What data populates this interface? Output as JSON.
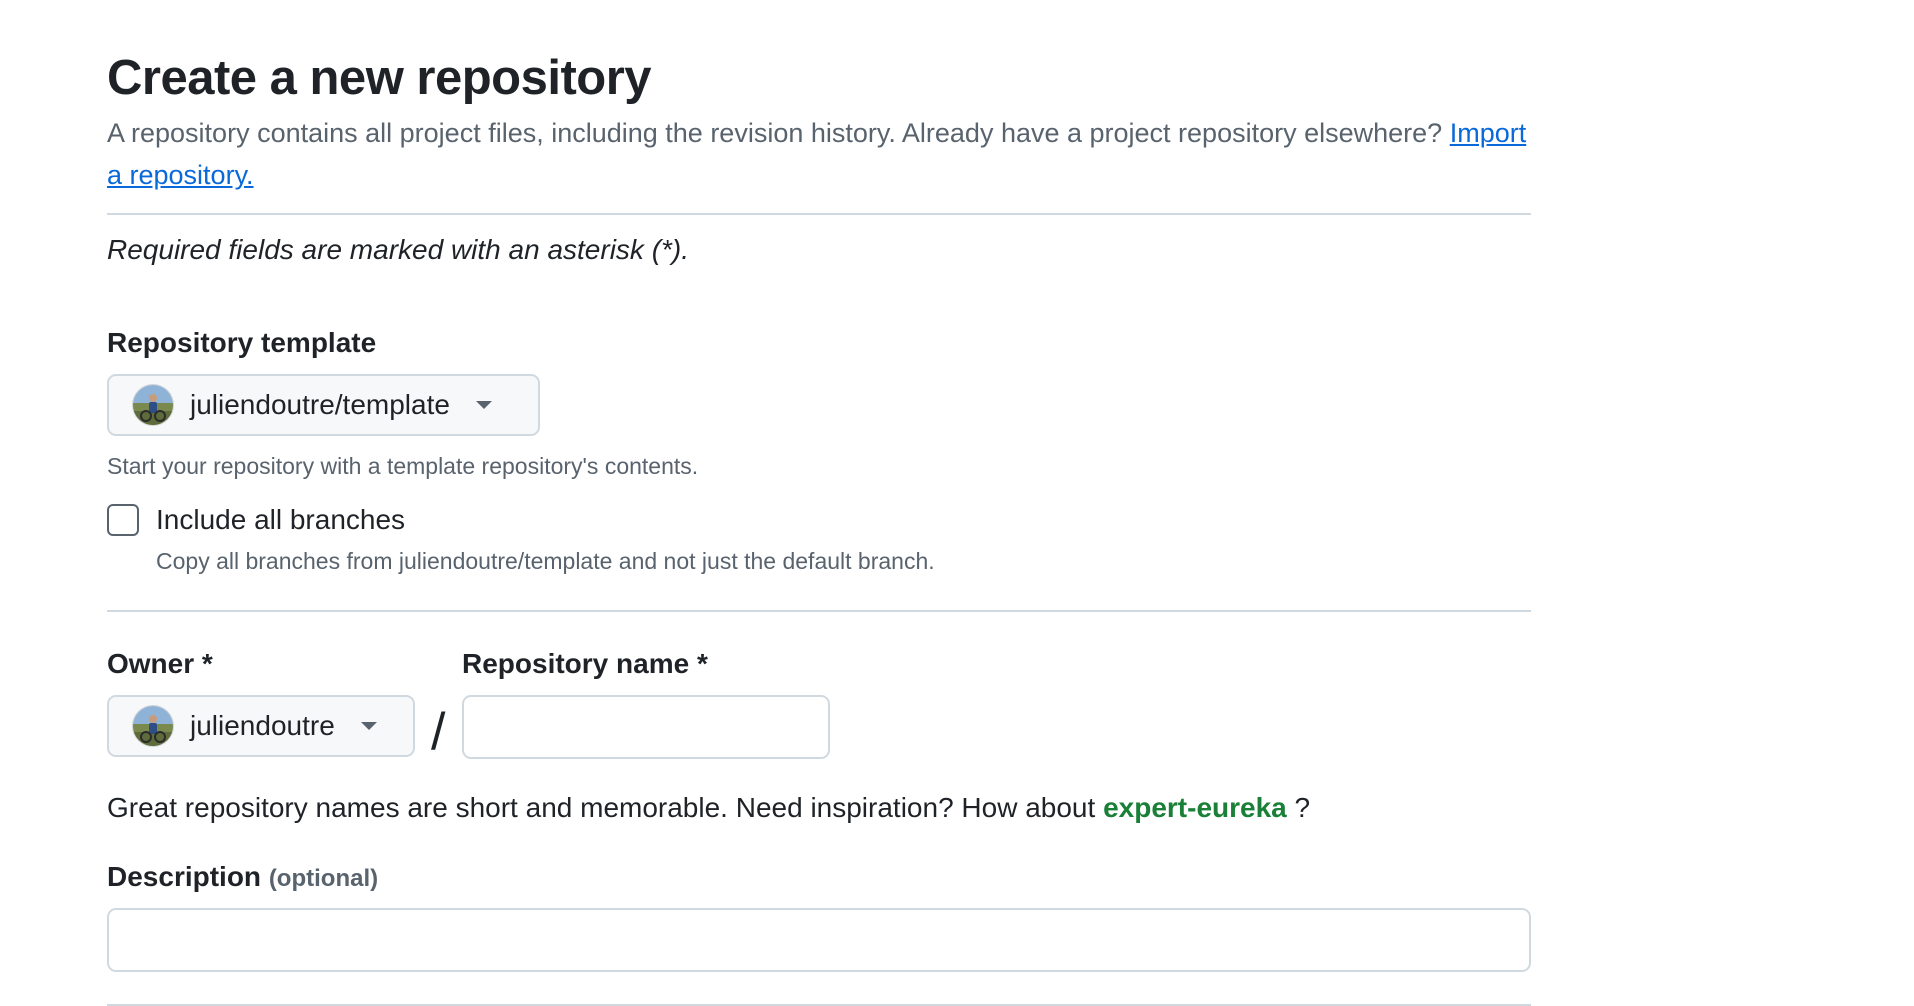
{
  "header": {
    "title": "Create a new repository",
    "intro_text": "A repository contains all project files, including the revision history. Already have a project repository elsewhere?",
    "import_link": "Import a repository."
  },
  "required_note": "Required fields are marked with an asterisk (*).",
  "template": {
    "label": "Repository template",
    "selected": "juliendoutre/template",
    "hint": "Start your repository with a template repository's contents.",
    "include_branches_label": "Include all branches",
    "include_branches_checked": false,
    "include_branches_hint": "Copy all branches from juliendoutre/template and not just the default branch."
  },
  "owner": {
    "label": "Owner *",
    "selected": "juliendoutre"
  },
  "separator": "/",
  "repo_name": {
    "label": "Repository name *",
    "value": ""
  },
  "suggestion": {
    "prefix": "Great repository names are short and memorable. Need inspiration? How about",
    "name": "expert-eureka",
    "suffix": " ?"
  },
  "description": {
    "label": "Description",
    "optional_label": "(optional)",
    "value": ""
  },
  "icons": {
    "avatar": "avatar-icon",
    "dropdown": "triangle-down-icon"
  },
  "colors": {
    "link": "#0969da",
    "suggestion": "#1a7f37",
    "muted": "#59636e",
    "border": "#d1d9e0"
  }
}
